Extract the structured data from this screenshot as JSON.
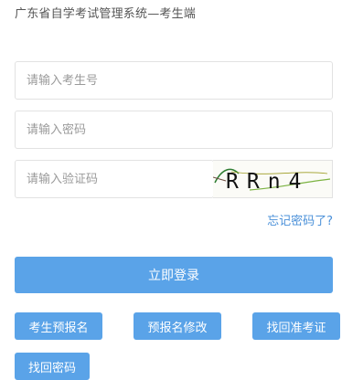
{
  "header": {
    "title": "广东省自学考试管理系统—考生端"
  },
  "form": {
    "username_placeholder": "请输入考生号",
    "password_placeholder": "请输入密码",
    "captcha_placeholder": "请输入验证码",
    "captcha_text": "RRn4",
    "forgot_password": "忘记密码了?"
  },
  "buttons": {
    "login": "立即登录",
    "pre_register": "考生预报名",
    "modify_registration": "预报名修改",
    "find_admission_number": "找回准考证",
    "find_password": "找回密码"
  },
  "colors": {
    "accent": "#5aa3e8",
    "link": "#4a90d9"
  }
}
